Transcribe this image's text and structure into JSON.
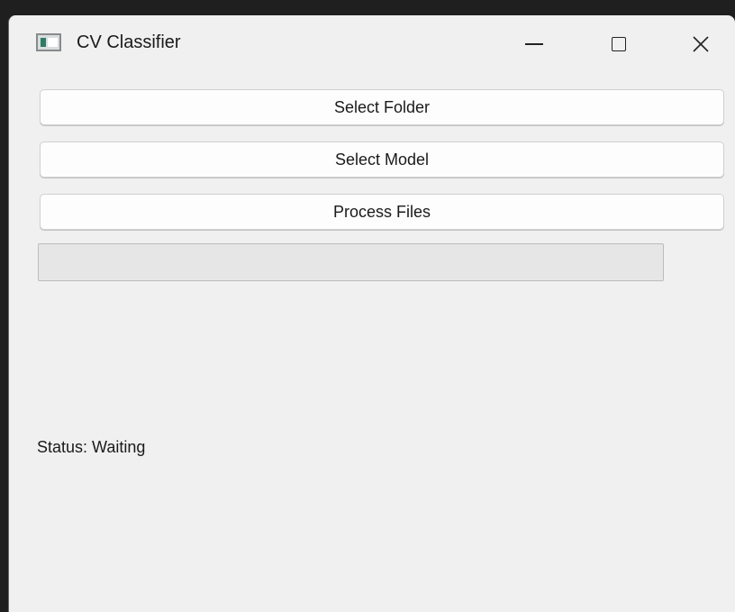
{
  "window": {
    "title": "CV Classifier",
    "icon": "app-window-icon"
  },
  "caption_buttons": {
    "minimize_icon": "minimize-icon",
    "maximize_icon": "maximize-icon",
    "close_icon": "close-icon",
    "close_glyph": "✕"
  },
  "buttons": {
    "select_folder": "Select Folder",
    "select_model": "Select Model",
    "process_files": "Process Files"
  },
  "progress": {
    "value": 0
  },
  "status": {
    "text": "Status: Waiting"
  },
  "colors": {
    "window_background": "#f0f0f0",
    "button_background": "#fdfdfd",
    "progress_track": "#e6e6e6",
    "progress_fill": "#06b025"
  }
}
